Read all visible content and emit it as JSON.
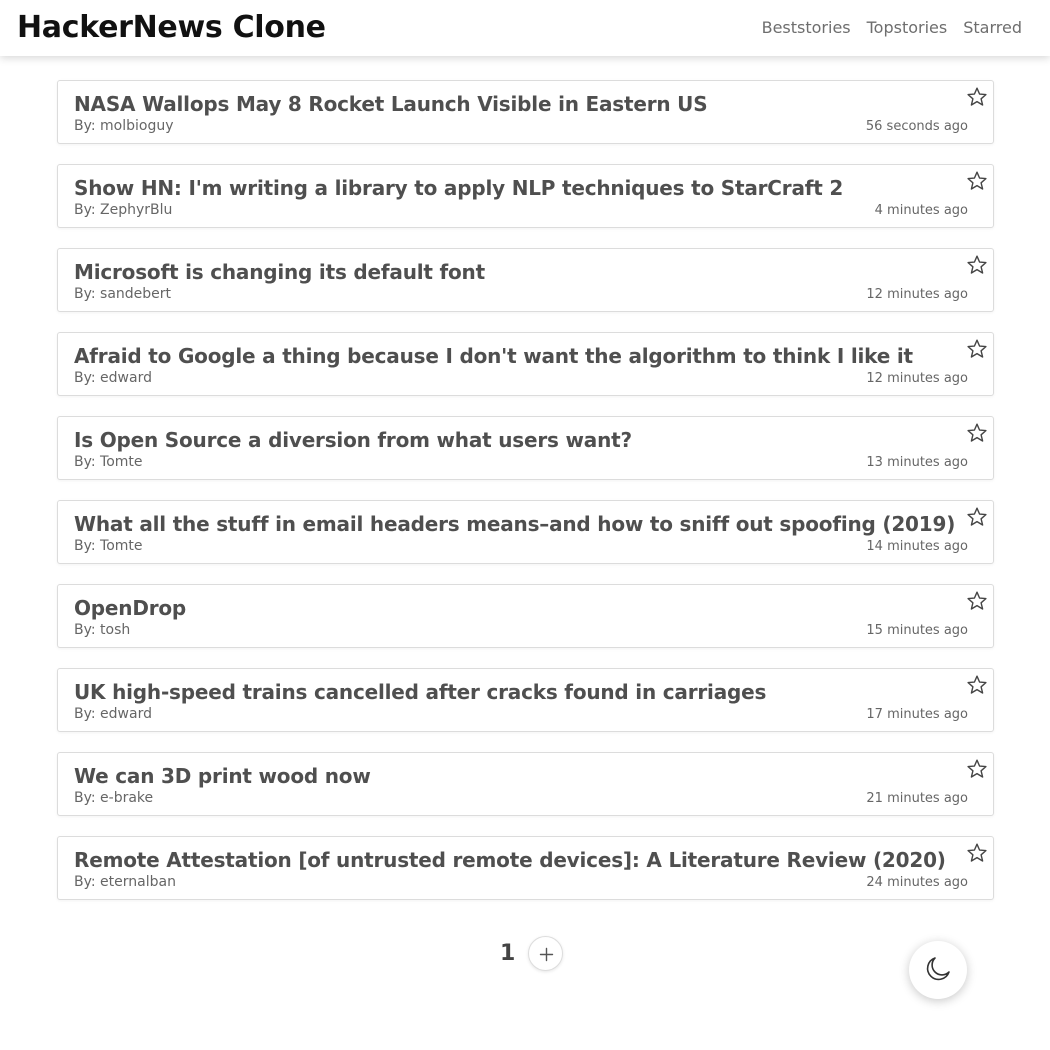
{
  "header": {
    "brand": "HackerNews Clone",
    "nav": [
      "Beststories",
      "Topstories",
      "Starred"
    ]
  },
  "stories": [
    {
      "title": "NASA Wallops May 8 Rocket Launch Visible in Eastern US",
      "by": "By: molbioguy",
      "time": "56 seconds ago"
    },
    {
      "title": "Show HN: I'm writing a library to apply NLP techniques to StarCraft 2",
      "by": "By: ZephyrBlu",
      "time": "4 minutes ago"
    },
    {
      "title": "Microsoft is changing its default font",
      "by": "By: sandebert",
      "time": "12 minutes ago"
    },
    {
      "title": "Afraid to Google a thing because I don't want the algorithm to think I like it",
      "by": "By: edward",
      "time": "12 minutes ago"
    },
    {
      "title": "Is Open Source a diversion from what users want?",
      "by": "By: Tomte",
      "time": "13 minutes ago"
    },
    {
      "title": "What all the stuff in email headers means–and how to sniff out spoofing (2019)",
      "by": "By: Tomte",
      "time": "14 minutes ago"
    },
    {
      "title": "OpenDrop",
      "by": "By: tosh",
      "time": "15 minutes ago"
    },
    {
      "title": "UK high-speed trains cancelled after cracks found in carriages",
      "by": "By: edward",
      "time": "17 minutes ago"
    },
    {
      "title": "We can 3D print wood now",
      "by": "By: e-brake",
      "time": "21 minutes ago"
    },
    {
      "title": "Remote Attestation [of untrusted remote devices]: A Literature Review (2020)",
      "by": "By: eternalban",
      "time": "24 minutes ago"
    }
  ],
  "pagination": {
    "current_page": "1",
    "next_icon": "plus-icon"
  },
  "icons": {
    "star": "star-outline-icon",
    "theme": "moon-icon"
  },
  "colors": {
    "title": "#4f4f4f",
    "brand": "#111111",
    "nav": "#6e6e6e"
  }
}
